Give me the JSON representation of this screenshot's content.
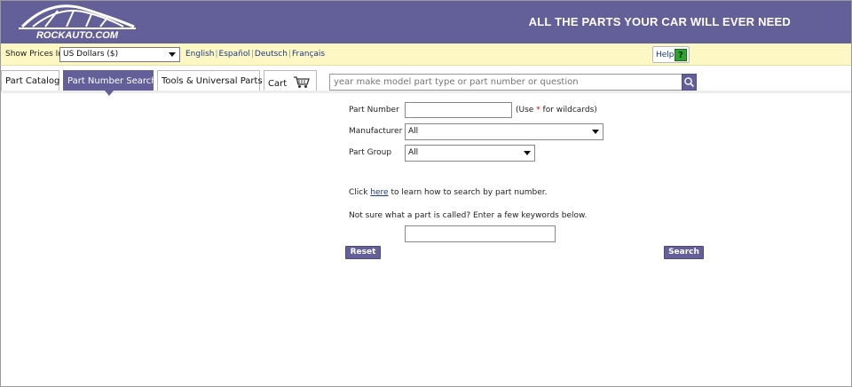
{
  "header": {
    "logo_text": "ROCKAUTO.COM",
    "tagline": "ALL THE PARTS YOUR CAR WILL EVER NEED"
  },
  "pricebar": {
    "show_prices_label": "Show Prices In",
    "currency_selected": "US Dollars ($)",
    "languages": [
      "English",
      "Español",
      "Deutsch",
      "Français"
    ],
    "help_label": "Help",
    "help_icon": "?"
  },
  "tabs": [
    {
      "label": "Part Catalog",
      "active": false
    },
    {
      "label": "Part Number Search",
      "active": true
    },
    {
      "label": "Tools & Universal Parts",
      "active": false
    },
    {
      "label": "Cart",
      "active": false
    }
  ],
  "search": {
    "placeholder": "year make model part type or part number or question",
    "button_icon": "search-icon"
  },
  "form": {
    "part_number_label": "Part Number",
    "part_number_value": "",
    "wildcard_hint_pre": "(Use ",
    "wildcard_star": "*",
    "wildcard_hint_post": " for wildcards)",
    "manufacturer_label": "Manufacturer",
    "manufacturer_selected": "All",
    "part_group_label": "Part Group",
    "part_group_selected": "All",
    "help_pre": "Click ",
    "help_link": "here",
    "help_post": " to learn how to search by part number.",
    "keywords_prompt": "Not sure what a part is called? Enter a few keywords below.",
    "keywords_value": "",
    "reset_label": "Reset",
    "search_label": "Search"
  },
  "colors": {
    "brand_purple": "#636099",
    "pricebar_yellow": "#fcf7c3",
    "help_green": "#2fa32f"
  }
}
